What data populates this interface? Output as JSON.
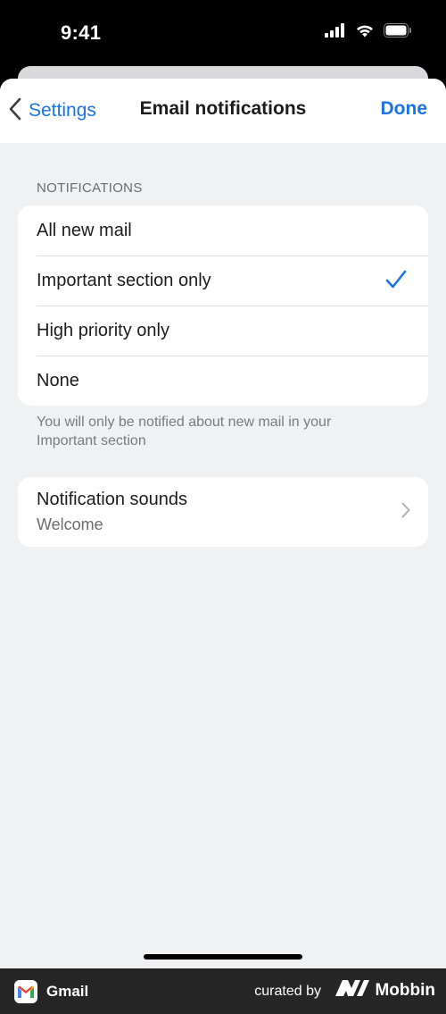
{
  "status_bar": {
    "time": "9:41",
    "icons": [
      "signal-icon",
      "wifi-icon",
      "battery-icon"
    ]
  },
  "nav": {
    "back_label": "Settings",
    "title": "Email notifications",
    "done_label": "Done"
  },
  "notifications": {
    "header": "NOTIFICATIONS",
    "options": [
      {
        "label": "All new mail",
        "selected": false
      },
      {
        "label": "Important section only",
        "selected": true
      },
      {
        "label": "High priority only",
        "selected": false
      },
      {
        "label": "None",
        "selected": false
      }
    ],
    "footer": "You will only be notified about new mail in your Important section"
  },
  "sounds": {
    "title": "Notification sounds",
    "value": "Welcome"
  },
  "brand_bar": {
    "app_name": "Gmail",
    "curated_by": "curated by",
    "brand": "Mobbin"
  },
  "colors": {
    "accent": "#1a73e8",
    "background": "#f0f1f3",
    "card": "#ffffff"
  }
}
